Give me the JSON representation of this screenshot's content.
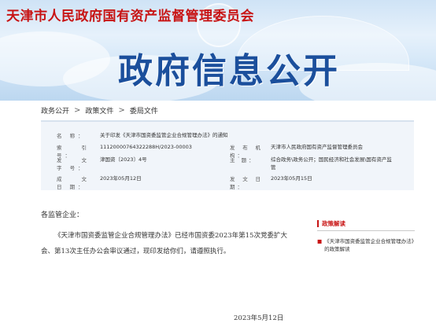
{
  "header": {
    "site_name": "天津市人民政府国有资产监督管理委员会",
    "banner_title": "政府信息公开"
  },
  "breadcrumb": {
    "items": [
      "政务公开",
      "政策文件",
      "委局文件"
    ],
    "separator": ">"
  },
  "meta": {
    "name_label": "名 称：",
    "name_value": "关于印发《天津市国资委监管企业合规管理办法》的通知",
    "index_label": "索 引 号：",
    "index_value": "11120000764322288H/2023-00003",
    "issuer_label": "发 布 机 构：",
    "issuer_value": "天津市人民政府国有资产监督管理委员会",
    "docno_label": "发 文 字 号：",
    "docno_value": "津国资〔2023〕4号",
    "subject_label": "主 题：",
    "subject_value": "综合政务\\政务公开；国民经济和社会发展\\国有资产监管",
    "date_label": "成 文 日 期：",
    "date_value": "2023年05月12日",
    "pub_label": "发 文 日 期：",
    "pub_value": "2023年05月15日"
  },
  "content": {
    "salutation": "各监管企业：",
    "paragraph": "《天津市国资委监管企业合规管理办法》已经市国资委2023年第15次党委扩大会、第13次主任办公会审议通过，现印发给你们，请遵照执行。",
    "date": "2023年5月12日"
  },
  "panel": {
    "heading": "政策解读",
    "item": "《天津市国资委监管企业合规管理办法》的政策解读"
  },
  "colors": {
    "brand_red": "#c81414",
    "banner_blue": "#1b4f9c",
    "meta_bg": "#f1f5fa"
  }
}
